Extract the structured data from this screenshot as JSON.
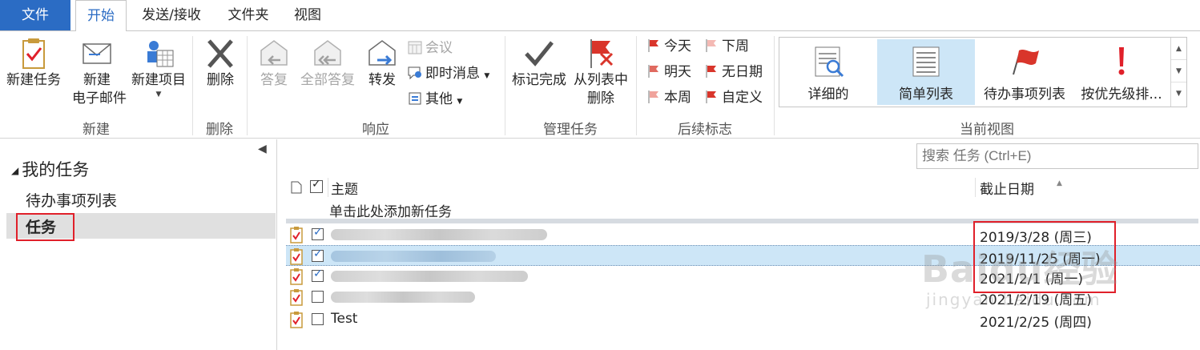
{
  "tabs": [
    "文件",
    "开始",
    "发送/接收",
    "文件夹",
    "视图"
  ],
  "ribbon": {
    "new": {
      "new_task": "新建任务",
      "new_email_1": "新建",
      "new_email_2": "电子邮件",
      "new_items": "新建项目",
      "label": "新建"
    },
    "delete": {
      "delete": "删除",
      "label": "删除"
    },
    "respond": {
      "reply": "答复",
      "reply_all": "全部答复",
      "forward": "转发",
      "meeting": "会议",
      "im": "即时消息",
      "more": "其他",
      "label": "响应"
    },
    "manage": {
      "mark_complete": "标记完成",
      "remove_1": "从列表中",
      "remove_2": "删除",
      "label": "管理任务"
    },
    "followup": {
      "today": "今天",
      "next_week": "下周",
      "tomorrow": "明天",
      "no_date": "无日期",
      "this_week": "本周",
      "custom": "自定义",
      "label": "后续标志"
    },
    "view": {
      "detailed": "详细的",
      "simple_list": "简单列表",
      "todo_list": "待办事项列表",
      "prioritized": "按优先级排...",
      "label": "当前视图"
    }
  },
  "nav": {
    "header": "我的任务",
    "items": [
      "待办事项列表",
      "任务"
    ]
  },
  "search": {
    "placeholder": "搜索 任务 (Ctrl+E)"
  },
  "list": {
    "col_subject": "主题",
    "col_due": "截止日期",
    "add_new": "单击此处添加新任务",
    "rows": [
      {
        "subject": "",
        "due": "2019/3/28 (周三)",
        "done": true
      },
      {
        "subject": "",
        "due": "2019/11/25 (周一)",
        "done": true
      },
      {
        "subject": "",
        "due": "2021/2/1 (周一)",
        "done": true
      },
      {
        "subject": "",
        "due": "2021/2/19 (周五)",
        "done": false
      },
      {
        "subject": "Test",
        "due": "2021/2/25 (周四)",
        "done": false
      }
    ]
  },
  "watermark": {
    "main": "Baidu经验",
    "sub": "jingyan.baidu.com"
  },
  "colors": {
    "accent": "#2b6cc4",
    "selection": "#cde6f7",
    "highlight_box": "#e0202a",
    "flag": "#d9352b"
  }
}
